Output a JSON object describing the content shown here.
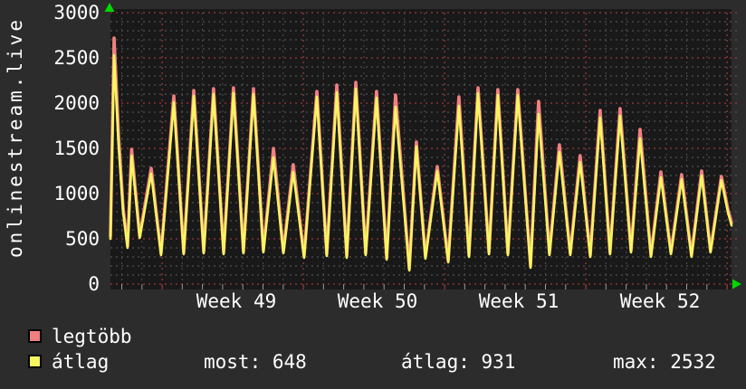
{
  "vertical_title": "onlinestream.live",
  "legend": {
    "items": [
      {
        "label": "legtöbb",
        "color": "#f08080"
      },
      {
        "label": "átlag",
        "color": "#f6f65f"
      }
    ],
    "stats": [
      "most: 648",
      "átlag: 931",
      "max: 2532"
    ]
  },
  "colors": {
    "page_bg": "#2c2c2c",
    "plot_bg": "#191919",
    "grid_minor": "#5e5e5e",
    "grid_minor_v": "#4f4f4f",
    "grid_major": "#bf4040",
    "tick": "#9a9a9a",
    "text": "#ffffff",
    "arrow": "#00d800"
  },
  "chart_data": {
    "type": "line",
    "title": "onlinestream.live",
    "ylim": [
      0,
      3000
    ],
    "y_ticks": [
      0,
      500,
      1000,
      1500,
      2000,
      2500,
      3000
    ],
    "y_minor_step": 100,
    "grid": true,
    "legend_position": "bottom-left",
    "x_axis": {
      "unit": "day",
      "week_labels": [
        "Week 49",
        "Week 50",
        "Week 51",
        "Week 52"
      ],
      "first_week_line_day": 2.56,
      "days_per_week": 7,
      "total_days": 30.78
    },
    "series": [
      {
        "name": "legtöbb",
        "role": "max",
        "color": "#f08080",
        "width": 3.6
      },
      {
        "name": "átlag",
        "role": "avg",
        "color": "#f6f65f",
        "width": 2.6
      }
    ],
    "summary": {
      "most": 648,
      "átlag": 931,
      "max": 2532
    },
    "points": [
      {
        "d": 0.0,
        "avg": 500,
        "max": 530
      },
      {
        "d": 0.18,
        "avg": 2530,
        "max": 2720
      },
      {
        "d": 0.4,
        "avg": 1550,
        "max": 1650
      },
      {
        "d": 0.63,
        "avg": 800,
        "max": 840
      },
      {
        "d": 0.85,
        "avg": 400,
        "max": 420
      },
      {
        "d": 1.05,
        "avg": 1420,
        "max": 1490
      },
      {
        "d": 1.45,
        "avg": 510,
        "max": 530
      },
      {
        "d": 2.02,
        "avg": 1220,
        "max": 1280
      },
      {
        "d": 2.51,
        "avg": 320,
        "max": 340
      },
      {
        "d": 3.14,
        "avg": 2010,
        "max": 2080
      },
      {
        "d": 3.63,
        "avg": 330,
        "max": 350
      },
      {
        "d": 4.13,
        "avg": 2080,
        "max": 2140
      },
      {
        "d": 4.62,
        "avg": 340,
        "max": 360
      },
      {
        "d": 5.11,
        "avg": 2100,
        "max": 2160
      },
      {
        "d": 5.61,
        "avg": 330,
        "max": 350
      },
      {
        "d": 6.1,
        "avg": 2110,
        "max": 2170
      },
      {
        "d": 6.59,
        "avg": 340,
        "max": 360
      },
      {
        "d": 7.09,
        "avg": 2100,
        "max": 2160
      },
      {
        "d": 7.58,
        "avg": 350,
        "max": 370
      },
      {
        "d": 8.08,
        "avg": 1400,
        "max": 1500
      },
      {
        "d": 8.57,
        "avg": 340,
        "max": 360
      },
      {
        "d": 9.06,
        "avg": 1240,
        "max": 1320
      },
      {
        "d": 9.6,
        "avg": 290,
        "max": 310
      },
      {
        "d": 10.23,
        "avg": 2070,
        "max": 2130
      },
      {
        "d": 10.72,
        "avg": 310,
        "max": 330
      },
      {
        "d": 11.22,
        "avg": 2120,
        "max": 2200
      },
      {
        "d": 11.71,
        "avg": 290,
        "max": 310
      },
      {
        "d": 12.16,
        "avg": 2160,
        "max": 2230
      },
      {
        "d": 12.65,
        "avg": 320,
        "max": 340
      },
      {
        "d": 13.19,
        "avg": 2060,
        "max": 2130
      },
      {
        "d": 13.69,
        "avg": 270,
        "max": 290
      },
      {
        "d": 14.13,
        "avg": 1960,
        "max": 2090
      },
      {
        "d": 14.81,
        "avg": 150,
        "max": 170
      },
      {
        "d": 15.16,
        "avg": 1520,
        "max": 1570
      },
      {
        "d": 15.61,
        "avg": 280,
        "max": 300
      },
      {
        "d": 16.2,
        "avg": 1250,
        "max": 1300
      },
      {
        "d": 16.74,
        "avg": 240,
        "max": 260
      },
      {
        "d": 17.27,
        "avg": 1970,
        "max": 2070
      },
      {
        "d": 17.77,
        "avg": 300,
        "max": 320
      },
      {
        "d": 18.22,
        "avg": 2110,
        "max": 2170
      },
      {
        "d": 18.76,
        "avg": 330,
        "max": 350
      },
      {
        "d": 19.2,
        "avg": 2090,
        "max": 2150
      },
      {
        "d": 19.7,
        "avg": 320,
        "max": 340
      },
      {
        "d": 20.19,
        "avg": 2090,
        "max": 2150
      },
      {
        "d": 20.82,
        "avg": 180,
        "max": 200
      },
      {
        "d": 21.22,
        "avg": 1880,
        "max": 2020
      },
      {
        "d": 21.76,
        "avg": 320,
        "max": 340
      },
      {
        "d": 22.25,
        "avg": 1460,
        "max": 1540
      },
      {
        "d": 22.79,
        "avg": 320,
        "max": 340
      },
      {
        "d": 23.28,
        "avg": 1350,
        "max": 1420
      },
      {
        "d": 23.78,
        "avg": 300,
        "max": 320
      },
      {
        "d": 24.27,
        "avg": 1840,
        "max": 1920
      },
      {
        "d": 24.76,
        "avg": 330,
        "max": 350
      },
      {
        "d": 25.26,
        "avg": 1860,
        "max": 1940
      },
      {
        "d": 25.8,
        "avg": 350,
        "max": 370
      },
      {
        "d": 26.25,
        "avg": 1610,
        "max": 1710
      },
      {
        "d": 26.79,
        "avg": 300,
        "max": 320
      },
      {
        "d": 27.28,
        "avg": 1180,
        "max": 1240
      },
      {
        "d": 27.78,
        "avg": 330,
        "max": 350
      },
      {
        "d": 28.31,
        "avg": 1160,
        "max": 1210
      },
      {
        "d": 28.8,
        "avg": 300,
        "max": 320
      },
      {
        "d": 29.3,
        "avg": 1200,
        "max": 1250
      },
      {
        "d": 29.74,
        "avg": 350,
        "max": 370
      },
      {
        "d": 30.28,
        "avg": 1150,
        "max": 1190
      },
      {
        "d": 30.6,
        "avg": 800,
        "max": 830
      },
      {
        "d": 30.78,
        "avg": 648,
        "max": 680
      }
    ]
  }
}
